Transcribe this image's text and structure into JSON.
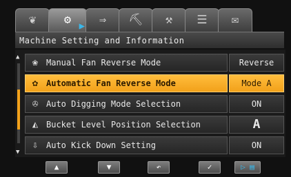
{
  "tabs": [
    {
      "icon": "leaf-icon",
      "glyph": "❦"
    },
    {
      "icon": "machine-settings-icon",
      "glyph": "⚙"
    },
    {
      "icon": "arrow-transfer-icon",
      "glyph": "⇒"
    },
    {
      "icon": "excavator-icon",
      "glyph": "⛏"
    },
    {
      "icon": "tool-icon",
      "glyph": "⚒"
    },
    {
      "icon": "document-list-icon",
      "glyph": "☰"
    },
    {
      "icon": "mail-icon",
      "glyph": "✉"
    }
  ],
  "header": {
    "title": "Machine Setting and Information"
  },
  "rows": [
    {
      "label": "Manual Fan Reverse Mode",
      "value": "Reverse",
      "icon": "fan-icon",
      "glyph": "❀"
    },
    {
      "label": "Automatic Fan Reverse Mode",
      "value": "Mode A",
      "icon": "auto-fan-icon",
      "glyph": "✿"
    },
    {
      "label": "Auto Digging Mode Selection",
      "value": "ON",
      "icon": "auto-dig-icon",
      "glyph": "✇"
    },
    {
      "label": "Bucket Level Position Selection",
      "value": "A",
      "icon": "bucket-level-icon",
      "glyph": "◭"
    },
    {
      "label": "Auto Kick Down Setting",
      "value": "ON",
      "icon": "kickdown-icon",
      "glyph": "⇩"
    }
  ],
  "bottom": {
    "up": "▲",
    "down": "▼",
    "back": "↶",
    "ok": "✓",
    "page": "▷ ▤"
  },
  "colors": {
    "highlight": "#f2a11a",
    "accent": "#3ab6e8"
  }
}
